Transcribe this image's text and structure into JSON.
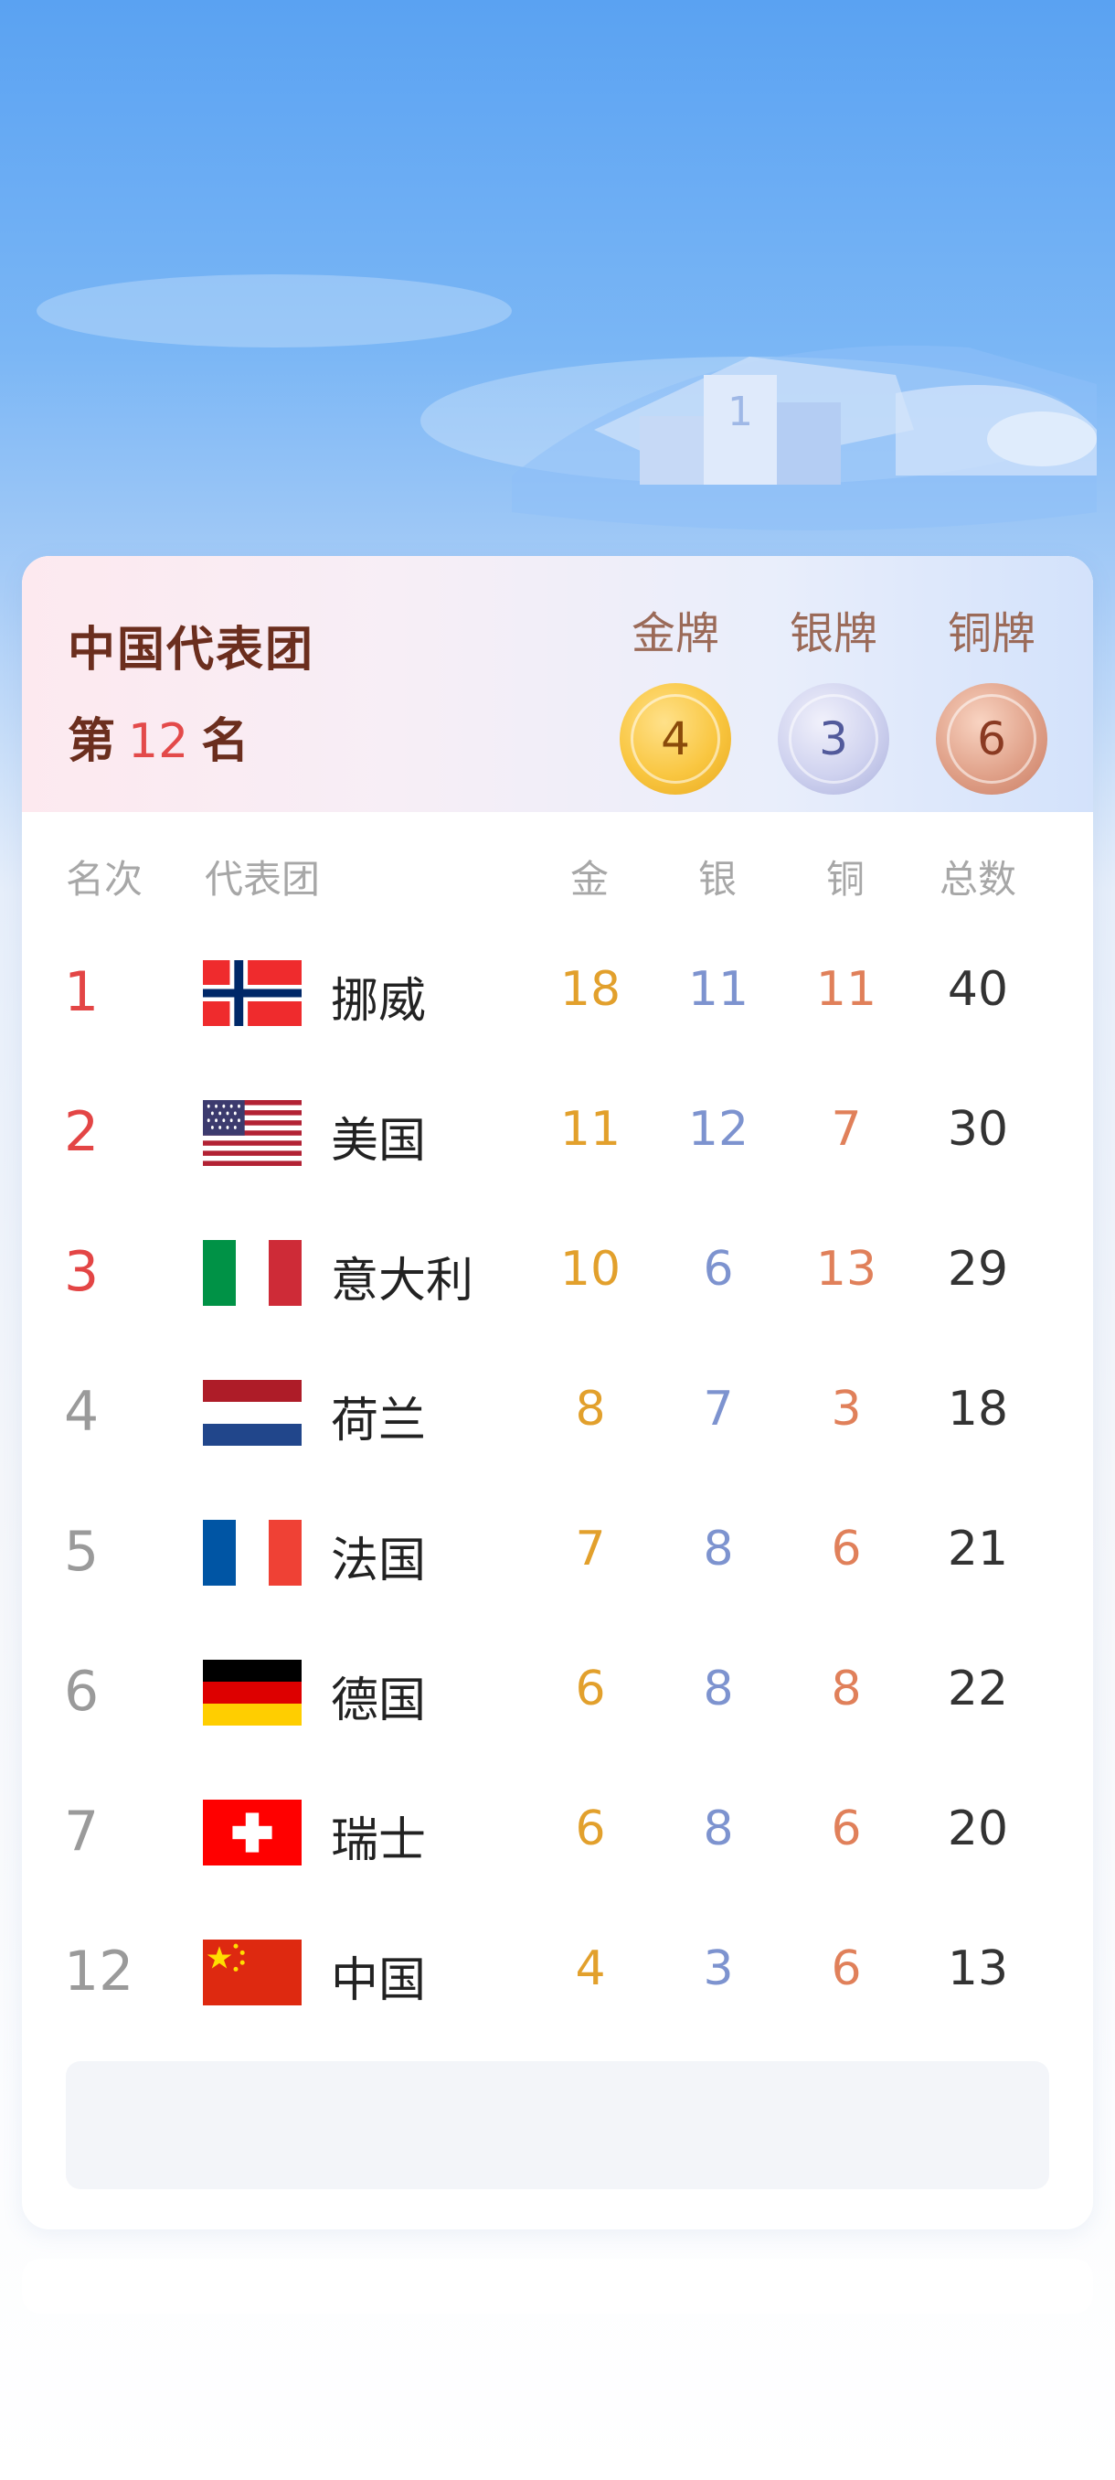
{
  "header": {
    "team_name": "中国代表团",
    "rank_prefix": "第",
    "rank_value": "12",
    "rank_suffix": "名",
    "medals": [
      {
        "label": "金牌",
        "count": "4"
      },
      {
        "label": "银牌",
        "count": "3"
      },
      {
        "label": "铜牌",
        "count": "6"
      }
    ]
  },
  "podium_number": "1",
  "table": {
    "columns": [
      "名次",
      "代表团",
      "金",
      "银",
      "铜",
      "总数"
    ],
    "rows": [
      {
        "rank": "1",
        "flag": "norway-flag",
        "country": "挪威",
        "gold": "18",
        "silver": "11",
        "bronze": "11",
        "total": "40"
      },
      {
        "rank": "2",
        "flag": "usa-flag",
        "country": "美国",
        "gold": "11",
        "silver": "12",
        "bronze": "7",
        "total": "30"
      },
      {
        "rank": "3",
        "flag": "italy-flag",
        "country": "意大利",
        "gold": "10",
        "silver": "6",
        "bronze": "13",
        "total": "29"
      },
      {
        "rank": "4",
        "flag": "netherlands-flag",
        "country": "荷兰",
        "gold": "8",
        "silver": "7",
        "bronze": "3",
        "total": "18"
      },
      {
        "rank": "5",
        "flag": "france-flag",
        "country": "法国",
        "gold": "7",
        "silver": "8",
        "bronze": "6",
        "total": "21"
      },
      {
        "rank": "6",
        "flag": "germany-flag",
        "country": "德国",
        "gold": "6",
        "silver": "8",
        "bronze": "8",
        "total": "22"
      },
      {
        "rank": "7",
        "flag": "switzerland-flag",
        "country": "瑞士",
        "gold": "6",
        "silver": "8",
        "bronze": "6",
        "total": "20"
      },
      {
        "rank": "12",
        "flag": "china-flag",
        "country": "中国",
        "gold": "4",
        "silver": "3",
        "bronze": "6",
        "total": "13"
      }
    ]
  },
  "colors": {
    "rank_top3": "#e34545",
    "gold_text": "#e2a02c",
    "silver_text": "#7d93cf",
    "bronze_text": "#e0805a",
    "title_brown": "#6b2e1e"
  }
}
